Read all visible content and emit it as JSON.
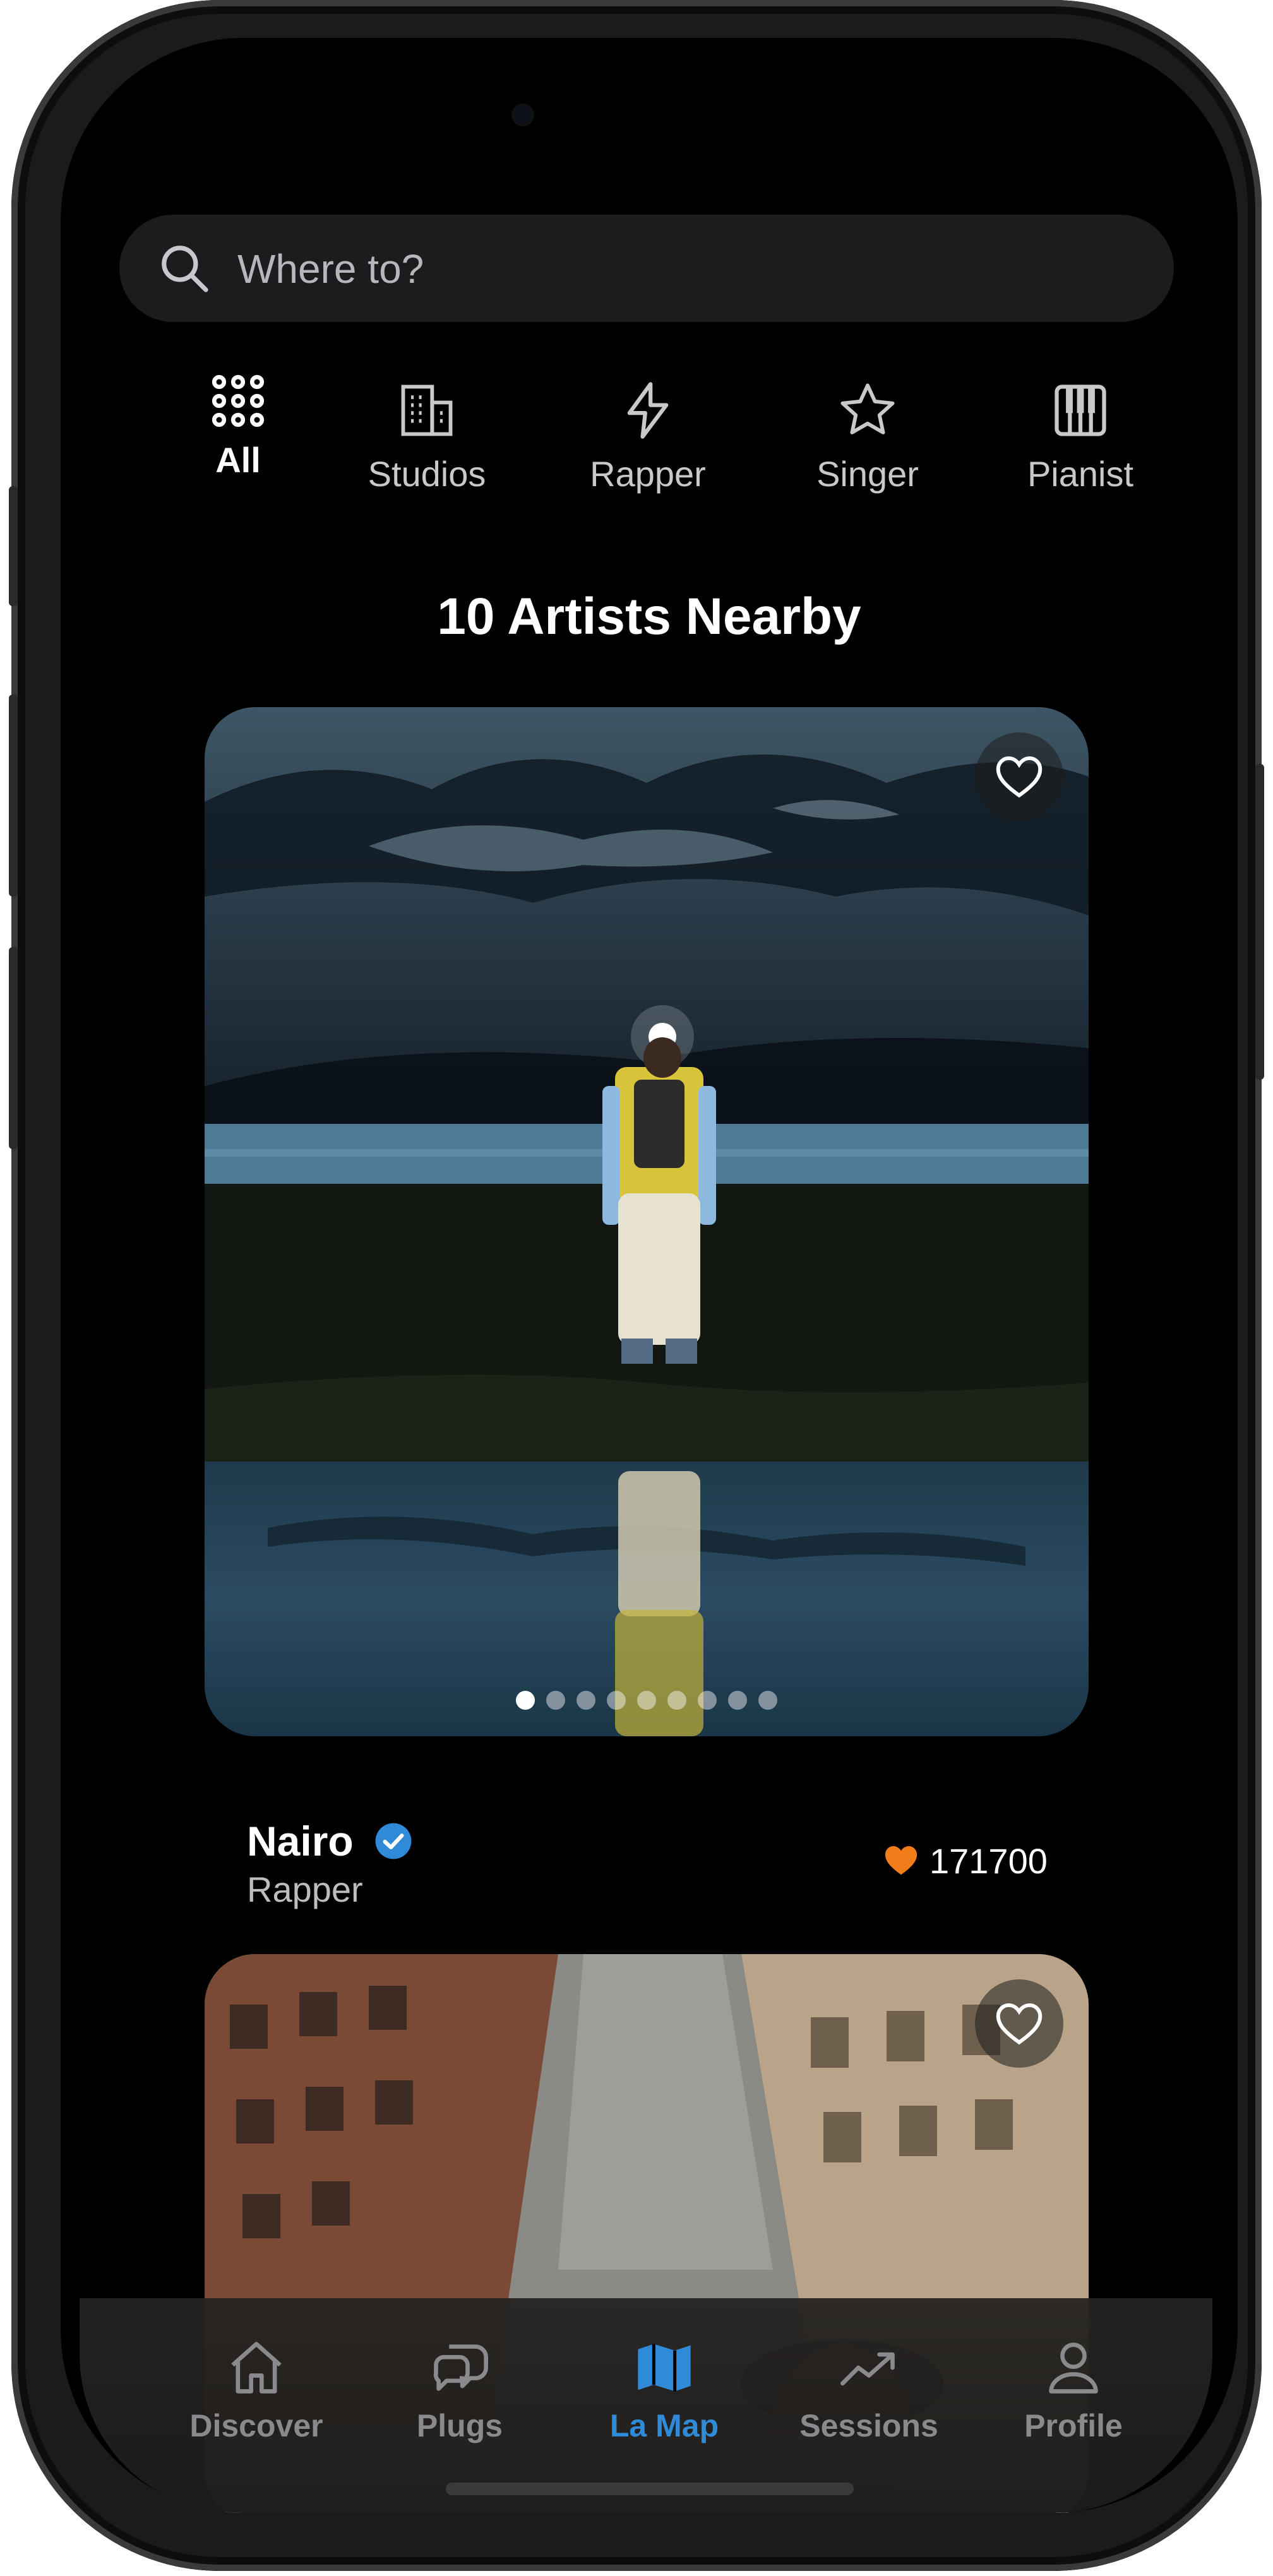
{
  "search": {
    "placeholder": "Where to?"
  },
  "categories": [
    {
      "label": "All",
      "icon": "grid-dots-icon",
      "active": true
    },
    {
      "label": "Studios",
      "icon": "building-icon"
    },
    {
      "label": "Rapper",
      "icon": "lightning-icon"
    },
    {
      "label": "Singer",
      "icon": "star-icon"
    },
    {
      "label": "Pianist",
      "icon": "piano-icon"
    }
  ],
  "heading": "10 Artists Nearby",
  "cards": [
    {
      "name": "Nairo",
      "verified": true,
      "role": "Rapper",
      "likes": "171700",
      "photo_count": 9,
      "current_photo": 1
    },
    {
      "name": "",
      "role": "",
      "likes": ""
    }
  ],
  "tabbar": [
    {
      "label": "Discover",
      "icon": "home-icon"
    },
    {
      "label": "Plugs",
      "icon": "chat-bubbles-icon"
    },
    {
      "label": "La Map",
      "icon": "map-icon",
      "active": true
    },
    {
      "label": "Sessions",
      "icon": "trend-icon"
    },
    {
      "label": "Profile",
      "icon": "person-icon"
    }
  ],
  "colors": {
    "accent": "#2f8ad8",
    "heart": "#f07d1a",
    "verified": "#2f8ad8"
  }
}
